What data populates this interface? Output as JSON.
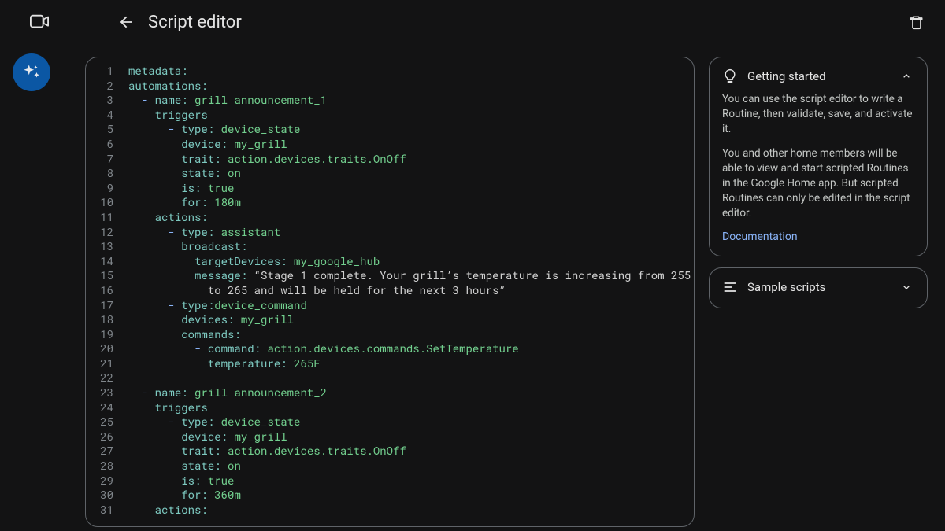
{
  "header": {
    "title": "Script editor"
  },
  "sidepanel": {
    "getting_started": {
      "title": "Getting started",
      "paragraph1": "You can use the script editor to write a Routine, then validate, save, and activate it.",
      "paragraph2": "You and other home members will be able to view and start scripted Routines in the Google Home app. But scripted Routines can only be edited in the script editor.",
      "doc_link": "Documentation"
    },
    "sample_scripts": {
      "title": "Sample scripts"
    }
  },
  "editor": {
    "line_count": 31,
    "script": {
      "metadata": {},
      "automations": [
        {
          "name": "grill announcement_1",
          "triggers": [
            {
              "type": "device_state",
              "device": "my_grill",
              "trait": "action.devices.traits.OnOff",
              "state": "on",
              "is": "true",
              "for": "180m"
            }
          ],
          "actions": [
            {
              "type": "assistant",
              "broadcast": {
                "targetDevices": "my_google_hub",
                "message": "“Stage 1 complete. Your grill’s temperature is increasing from 255 to 265 and will be held for the next 3 hours”"
              }
            },
            {
              "type": "device_command",
              "devices": "my_grill",
              "commands": [
                {
                  "command": "action.devices.commands.SetTemperature",
                  "temperature": "265F"
                }
              ]
            }
          ]
        },
        {
          "name": "grill announcement_2",
          "triggers": [
            {
              "type": "device_state",
              "device": "my_grill",
              "trait": "action.devices.traits.OnOff",
              "state": "on",
              "is": "true",
              "for": "360m"
            }
          ],
          "actions": []
        }
      ]
    }
  }
}
